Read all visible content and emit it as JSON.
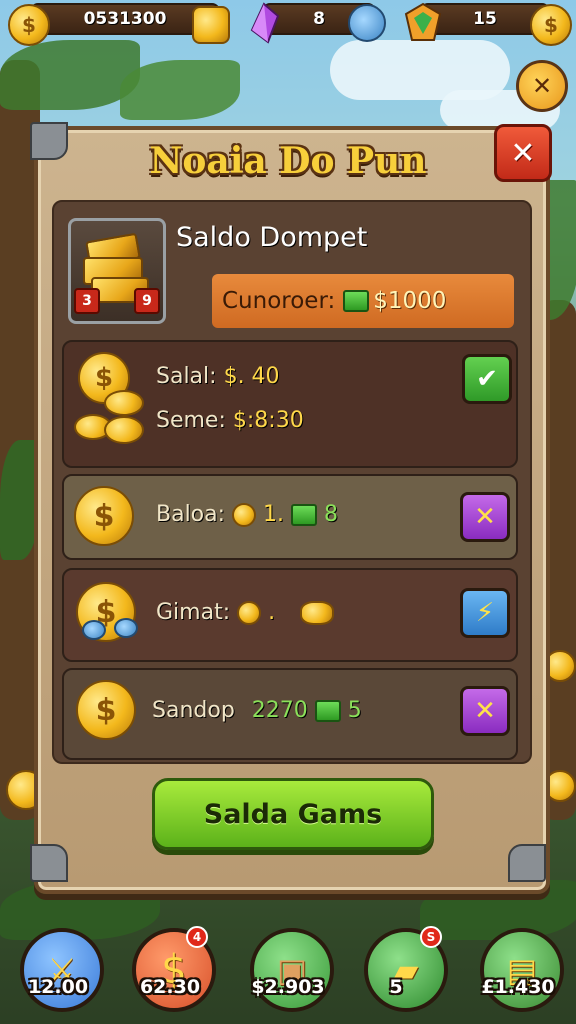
{
  "hud": {
    "coins_value": "0531300",
    "crystal_value": "8",
    "trophy_value": "15",
    "coin_symbol": "$"
  },
  "dialog": {
    "title": "Noaia Do Pun",
    "close_glyph": "✕",
    "wallet": {
      "title": "Saldo Dompet",
      "badge_left": "3",
      "badge_right": "9",
      "balance_label": "Cunoroer:",
      "balance_value": "$1000"
    },
    "rows": [
      {
        "line1_label": "Salal:",
        "line1_value": "$. 40",
        "line2_label": "Seme:",
        "line2_value": "$:8:30",
        "action_glyph": "✔",
        "action_color": "green"
      },
      {
        "label": "Baloa:",
        "value_a": "1.",
        "value_b": "8",
        "action_glyph": "✕",
        "action_color": "purple"
      },
      {
        "label": "Gimat:",
        "value_a": ".",
        "value_b": "",
        "action_glyph": "⚡",
        "action_color": "blue"
      },
      {
        "label": "Sandop",
        "value_a": "2270",
        "value_b": "5",
        "action_glyph": "✕",
        "action_color": "purple"
      }
    ],
    "cta_label": "Salda Gams"
  },
  "dock": [
    {
      "label": "12.00",
      "icon": "sword-icon",
      "color": "#3a7ad8",
      "glyph": "⚔"
    },
    {
      "label": "62.30",
      "icon": "dollar-icon",
      "color": "#d8502a",
      "glyph": "$",
      "badge": "4"
    },
    {
      "label": "$2.903",
      "icon": "treasure-box-icon",
      "color": "#3a9a3a",
      "glyph": "▣"
    },
    {
      "label": "5",
      "icon": "gold-bar-icon",
      "color": "#2e8a2e",
      "glyph": "▰",
      "badge": "S"
    },
    {
      "label": "£1.430",
      "icon": "gold-chest-icon",
      "color": "#3a8a32",
      "glyph": "▤"
    }
  ],
  "colors": {
    "title": "#f7cf3b",
    "cta": "#7ccf2a",
    "close": "#d83a22"
  }
}
